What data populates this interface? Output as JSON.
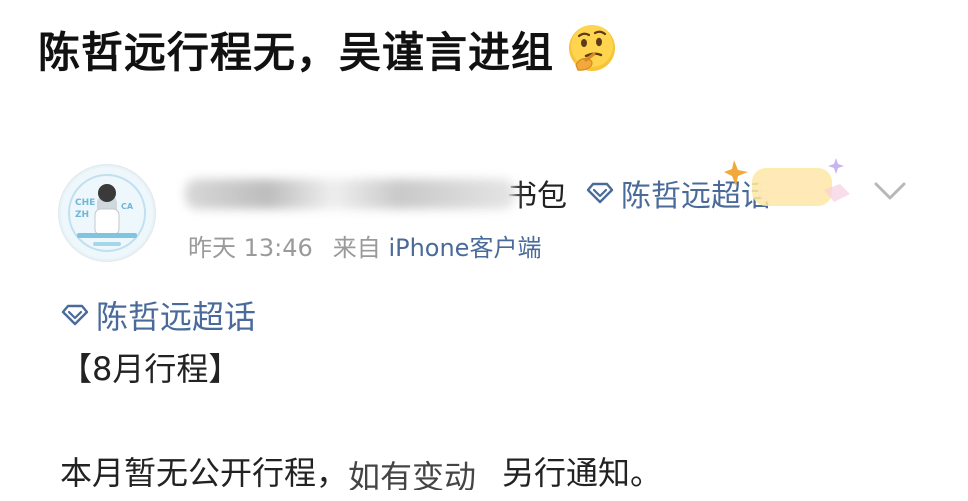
{
  "headline": {
    "text": "陈哲远行程无，吴谨言进组",
    "emoji": "thinking-face-emoji"
  },
  "post": {
    "avatar": {
      "label": "avatar"
    },
    "user": {
      "name_visible_tail": "书包",
      "topic": "陈哲远超话"
    },
    "meta": {
      "date": "昨天 13:46",
      "source_prefix": "来自",
      "device": "iPhone客户端"
    },
    "content": {
      "topic_tag": "陈哲远超话",
      "bracket_title": "【8月行程】",
      "notice_part1": "本月暂无公开行程，",
      "notice_part2": "如有变动",
      "notice_part3": "另行通知。"
    }
  },
  "colors": {
    "link": "#4a6b9a",
    "meta": "#9a9a9a",
    "text": "#222222",
    "headline": "#111111"
  }
}
